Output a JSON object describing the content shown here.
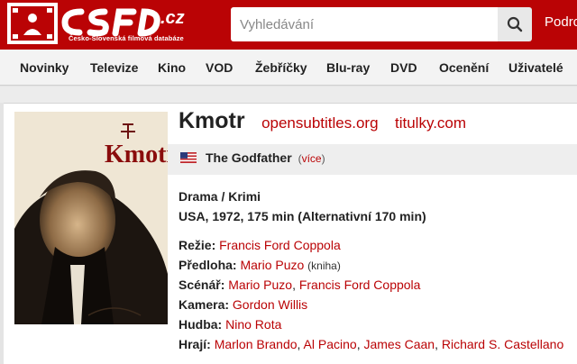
{
  "header": {
    "logo_text": "CSFD.cz",
    "logo_tagline": "Česko-Slovenská filmová databáze",
    "search_placeholder": "Vyhledávání",
    "right_link": "Podro"
  },
  "nav": {
    "items": [
      "Novinky",
      "Televize",
      "Kino",
      "VOD",
      "Žebříčky",
      "Blu-ray",
      "DVD",
      "Ocenění",
      "Uživatelé"
    ]
  },
  "film": {
    "title": "Kmotr",
    "links": [
      "opensubtitles.org",
      "titulky.com"
    ],
    "original_title": "The Godfather",
    "more_open": "(",
    "more_label": "více",
    "more_close": ")",
    "genres": "Drama / Krimi",
    "origin": "USA, 1972, 175 min (Alternativní 170 min)",
    "poster_title": "Kmotr",
    "flag": "us-flag-icon"
  },
  "crew": [
    {
      "label": "Režie:",
      "people": [
        "Francis Ford Coppola"
      ],
      "note": ""
    },
    {
      "label": "Předloha:",
      "people": [
        "Mario Puzo"
      ],
      "note": "(kniha)"
    },
    {
      "label": "Scénář:",
      "people": [
        "Mario Puzo",
        "Francis Ford Coppola"
      ],
      "note": ""
    },
    {
      "label": "Kamera:",
      "people": [
        "Gordon Willis"
      ],
      "note": ""
    },
    {
      "label": "Hudba:",
      "people": [
        "Nino Rota"
      ],
      "note": ""
    },
    {
      "label": "Hrají:",
      "people": [
        "Marlon Brando",
        "Al Pacino",
        "James Caan",
        "Richard S. Castellano"
      ],
      "note": ""
    }
  ],
  "colors": {
    "brand_red": "#ba0305",
    "link_red": "#ba0305",
    "nav_bg": "#f3f3f3",
    "band_bg": "#eeeeee"
  }
}
